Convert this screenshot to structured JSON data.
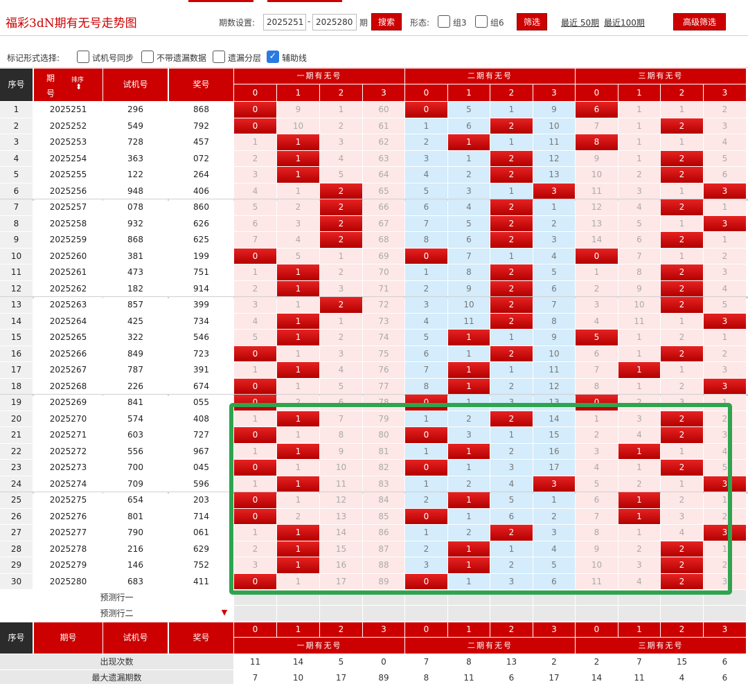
{
  "header": {
    "title": "福彩3dN期有无号走势图",
    "period_label": "期数设置:",
    "period_start": "2025251",
    "period_dash": "-",
    "period_end": "2025280",
    "period_unit": "期",
    "search_label": "搜索",
    "form_label": "形态:",
    "group3_label": "组3",
    "group6_label": "组6",
    "filter_label": "筛选",
    "recent50": "最近 50期",
    "recent100": "最近100期",
    "advanced_label": "高级筛选"
  },
  "marking": {
    "label": "标记形式选择:",
    "options": [
      {
        "label": "试机号同步",
        "checked": false
      },
      {
        "label": "不带遗漏数据",
        "checked": false
      },
      {
        "label": "遗漏分层",
        "checked": false
      },
      {
        "label": "辅助线",
        "checked": true
      }
    ]
  },
  "table": {
    "col_seq": "序号",
    "col_period_top": "期",
    "col_period_bottom": "号",
    "col_sort": "排序",
    "col_sort_icon": "sort-arrows",
    "col_trial": "试机号",
    "col_prize": "奖号",
    "col_period_footer": "期号",
    "groups": [
      "一期有无号",
      "二期有无号",
      "三期有无号"
    ],
    "digits": [
      "0",
      "1",
      "2",
      "3"
    ],
    "rows": [
      {
        "seq": "1",
        "period": "2025251",
        "trial": "296",
        "prize": "868",
        "cells": [
          [
            0,
            9,
            1,
            60
          ],
          [
            0,
            5,
            1,
            9
          ],
          [
            6,
            1,
            1,
            2
          ]
        ]
      },
      {
        "seq": "2",
        "period": "2025252",
        "trial": "549",
        "prize": "792",
        "cells": [
          [
            0,
            10,
            2,
            61
          ],
          [
            1,
            6,
            2,
            10
          ],
          [
            7,
            1,
            2,
            3
          ]
        ]
      },
      {
        "seq": "3",
        "period": "2025253",
        "trial": "728",
        "prize": "457",
        "cells": [
          [
            1,
            1,
            3,
            62
          ],
          [
            2,
            1,
            1,
            11
          ],
          [
            8,
            1,
            1,
            4
          ]
        ]
      },
      {
        "seq": "4",
        "period": "2025254",
        "trial": "363",
        "prize": "072",
        "cells": [
          [
            2,
            1,
            4,
            63
          ],
          [
            3,
            1,
            2,
            12
          ],
          [
            9,
            1,
            2,
            5
          ]
        ]
      },
      {
        "seq": "5",
        "period": "2025255",
        "trial": "122",
        "prize": "264",
        "cells": [
          [
            3,
            1,
            5,
            64
          ],
          [
            4,
            2,
            2,
            13
          ],
          [
            10,
            2,
            2,
            6
          ]
        ]
      },
      {
        "seq": "6",
        "period": "2025256",
        "trial": "948",
        "prize": "406",
        "cells": [
          [
            4,
            1,
            2,
            65
          ],
          [
            5,
            3,
            1,
            3
          ],
          [
            11,
            3,
            1,
            3
          ]
        ]
      },
      {
        "seq": "7",
        "period": "2025257",
        "trial": "078",
        "prize": "860",
        "cells": [
          [
            5,
            2,
            2,
            66
          ],
          [
            6,
            4,
            2,
            1
          ],
          [
            12,
            4,
            2,
            1
          ]
        ]
      },
      {
        "seq": "8",
        "period": "2025258",
        "trial": "932",
        "prize": "626",
        "cells": [
          [
            6,
            3,
            2,
            67
          ],
          [
            7,
            5,
            2,
            2
          ],
          [
            13,
            5,
            1,
            3
          ]
        ]
      },
      {
        "seq": "9",
        "period": "2025259",
        "trial": "868",
        "prize": "625",
        "cells": [
          [
            7,
            4,
            2,
            68
          ],
          [
            8,
            6,
            2,
            3
          ],
          [
            14,
            6,
            2,
            1
          ]
        ]
      },
      {
        "seq": "10",
        "period": "2025260",
        "trial": "381",
        "prize": "199",
        "cells": [
          [
            0,
            5,
            1,
            69
          ],
          [
            0,
            7,
            1,
            4
          ],
          [
            0,
            7,
            1,
            2
          ]
        ]
      },
      {
        "seq": "11",
        "period": "2025261",
        "trial": "473",
        "prize": "751",
        "cells": [
          [
            1,
            1,
            2,
            70
          ],
          [
            1,
            8,
            2,
            5
          ],
          [
            1,
            8,
            2,
            3
          ]
        ]
      },
      {
        "seq": "12",
        "period": "2025262",
        "trial": "182",
        "prize": "914",
        "cells": [
          [
            2,
            1,
            3,
            71
          ],
          [
            2,
            9,
            2,
            6
          ],
          [
            2,
            9,
            2,
            4
          ]
        ]
      },
      {
        "seq": "13",
        "period": "2025263",
        "trial": "857",
        "prize": "399",
        "cells": [
          [
            3,
            1,
            2,
            72
          ],
          [
            3,
            10,
            2,
            7
          ],
          [
            3,
            10,
            2,
            5
          ]
        ]
      },
      {
        "seq": "14",
        "period": "2025264",
        "trial": "425",
        "prize": "734",
        "cells": [
          [
            4,
            1,
            1,
            73
          ],
          [
            4,
            11,
            2,
            8
          ],
          [
            4,
            11,
            1,
            3
          ]
        ]
      },
      {
        "seq": "15",
        "period": "2025265",
        "trial": "322",
        "prize": "546",
        "cells": [
          [
            5,
            1,
            2,
            74
          ],
          [
            5,
            1,
            1,
            9
          ],
          [
            5,
            1,
            2,
            1
          ]
        ]
      },
      {
        "seq": "16",
        "period": "2025266",
        "trial": "849",
        "prize": "723",
        "cells": [
          [
            0,
            1,
            3,
            75
          ],
          [
            6,
            1,
            2,
            10
          ],
          [
            6,
            1,
            2,
            2
          ]
        ]
      },
      {
        "seq": "17",
        "period": "2025267",
        "trial": "787",
        "prize": "391",
        "cells": [
          [
            1,
            1,
            4,
            76
          ],
          [
            7,
            1,
            1,
            11
          ],
          [
            7,
            1,
            1,
            3
          ]
        ]
      },
      {
        "seq": "18",
        "period": "2025268",
        "trial": "226",
        "prize": "674",
        "cells": [
          [
            0,
            1,
            5,
            77
          ],
          [
            8,
            1,
            2,
            12
          ],
          [
            8,
            1,
            2,
            3
          ]
        ]
      },
      {
        "seq": "19",
        "period": "2025269",
        "trial": "841",
        "prize": "055",
        "cells": [
          [
            0,
            2,
            6,
            78
          ],
          [
            0,
            1,
            3,
            13
          ],
          [
            0,
            2,
            3,
            1
          ]
        ]
      },
      {
        "seq": "20",
        "period": "2025270",
        "trial": "574",
        "prize": "408",
        "cells": [
          [
            1,
            1,
            7,
            79
          ],
          [
            1,
            2,
            2,
            14
          ],
          [
            1,
            3,
            2,
            2
          ]
        ]
      },
      {
        "seq": "21",
        "period": "2025271",
        "trial": "603",
        "prize": "727",
        "cells": [
          [
            0,
            1,
            8,
            80
          ],
          [
            0,
            3,
            1,
            15
          ],
          [
            2,
            4,
            2,
            3
          ]
        ]
      },
      {
        "seq": "22",
        "period": "2025272",
        "trial": "556",
        "prize": "967",
        "cells": [
          [
            1,
            1,
            9,
            81
          ],
          [
            1,
            1,
            2,
            16
          ],
          [
            3,
            1,
            1,
            4
          ]
        ]
      },
      {
        "seq": "23",
        "period": "2025273",
        "trial": "700",
        "prize": "045",
        "cells": [
          [
            0,
            1,
            10,
            82
          ],
          [
            0,
            1,
            3,
            17
          ],
          [
            4,
            1,
            2,
            5
          ]
        ]
      },
      {
        "seq": "24",
        "period": "2025274",
        "trial": "709",
        "prize": "596",
        "cells": [
          [
            1,
            1,
            11,
            83
          ],
          [
            1,
            2,
            4,
            3
          ],
          [
            5,
            2,
            1,
            3
          ]
        ]
      },
      {
        "seq": "25",
        "period": "2025275",
        "trial": "654",
        "prize": "203",
        "cells": [
          [
            0,
            1,
            12,
            84
          ],
          [
            2,
            1,
            5,
            1
          ],
          [
            6,
            1,
            2,
            1
          ]
        ]
      },
      {
        "seq": "26",
        "period": "2025276",
        "trial": "801",
        "prize": "714",
        "cells": [
          [
            0,
            2,
            13,
            85
          ],
          [
            0,
            1,
            6,
            2
          ],
          [
            7,
            1,
            3,
            2
          ]
        ]
      },
      {
        "seq": "27",
        "period": "2025277",
        "trial": "790",
        "prize": "061",
        "cells": [
          [
            1,
            1,
            14,
            86
          ],
          [
            1,
            2,
            2,
            3
          ],
          [
            8,
            1,
            4,
            3
          ]
        ]
      },
      {
        "seq": "28",
        "period": "2025278",
        "trial": "216",
        "prize": "629",
        "cells": [
          [
            2,
            1,
            15,
            87
          ],
          [
            2,
            1,
            1,
            4
          ],
          [
            9,
            2,
            2,
            1
          ]
        ]
      },
      {
        "seq": "29",
        "period": "2025279",
        "trial": "146",
        "prize": "752",
        "cells": [
          [
            3,
            1,
            16,
            88
          ],
          [
            3,
            1,
            2,
            5
          ],
          [
            10,
            3,
            2,
            2
          ]
        ]
      },
      {
        "seq": "30",
        "period": "2025280",
        "trial": "683",
        "prize": "411",
        "cells": [
          [
            0,
            1,
            17,
            89
          ],
          [
            0,
            1,
            3,
            6
          ],
          [
            11,
            4,
            2,
            3
          ]
        ]
      }
    ],
    "hits": [
      [
        [
          0
        ],
        [
          0
        ],
        [
          0
        ]
      ],
      [
        [
          0
        ],
        [
          2
        ],
        [
          2
        ]
      ],
      [
        [
          1
        ],
        [
          1
        ],
        [
          0
        ]
      ],
      [
        [
          1
        ],
        [
          2
        ],
        [
          2
        ]
      ],
      [
        [
          1
        ],
        [
          2
        ],
        [
          2
        ]
      ],
      [
        [
          2
        ],
        [
          3
        ],
        [
          3
        ]
      ],
      [
        [
          2
        ],
        [
          2
        ],
        [
          2
        ]
      ],
      [
        [
          2
        ],
        [
          2
        ],
        [
          3
        ]
      ],
      [
        [
          2
        ],
        [
          2
        ],
        [
          2
        ]
      ],
      [
        [
          0
        ],
        [
          0
        ],
        [
          0
        ]
      ],
      [
        [
          1
        ],
        [
          2
        ],
        [
          2
        ]
      ],
      [
        [
          1
        ],
        [
          2
        ],
        [
          2
        ]
      ],
      [
        [
          2
        ],
        [
          2
        ],
        [
          2
        ]
      ],
      [
        [
          1
        ],
        [
          2
        ],
        [
          3
        ]
      ],
      [
        [
          1
        ],
        [
          1
        ],
        [
          0
        ]
      ],
      [
        [
          0
        ],
        [
          2
        ],
        [
          2
        ]
      ],
      [
        [
          1
        ],
        [
          1
        ],
        [
          1
        ]
      ],
      [
        [
          0
        ],
        [
          1
        ],
        [
          3
        ]
      ],
      [
        [
          0
        ],
        [
          0
        ],
        [
          0
        ]
      ],
      [
        [
          1
        ],
        [
          2
        ],
        [
          2
        ]
      ],
      [
        [
          0
        ],
        [
          0
        ],
        [
          2
        ]
      ],
      [
        [
          1
        ],
        [
          1
        ],
        [
          1
        ]
      ],
      [
        [
          0
        ],
        [
          0
        ],
        [
          2
        ]
      ],
      [
        [
          1
        ],
        [
          3
        ],
        [
          3
        ]
      ],
      [
        [
          0
        ],
        [
          1
        ],
        [
          1
        ]
      ],
      [
        [
          0
        ],
        [
          0
        ],
        [
          1
        ]
      ],
      [
        [
          1
        ],
        [
          2
        ],
        [
          3
        ]
      ],
      [
        [
          1
        ],
        [
          1
        ],
        [
          2
        ]
      ],
      [
        [
          1
        ],
        [
          1
        ],
        [
          2
        ]
      ],
      [
        [
          0
        ],
        [
          0
        ],
        [
          2
        ]
      ]
    ],
    "predict1": "预测行一",
    "predict2": "预测行二",
    "predict2_icon": "arrow-down-icon",
    "occurrences_label": "出现次数",
    "occurrences": [
      "11",
      "14",
      "5",
      "0",
      "7",
      "8",
      "13",
      "2",
      "2",
      "7",
      "15",
      "6"
    ],
    "max_miss_label": "最大遗漏期数",
    "max_miss": [
      "7",
      "10",
      "17",
      "89",
      "8",
      "11",
      "6",
      "17",
      "14",
      "11",
      "4",
      "6"
    ]
  },
  "colors": {
    "accent": "#cc0000",
    "highlight_box": "#2ea44f",
    "blue_zone": "#d4ecfb",
    "pink_zone": "#fde7e7"
  }
}
